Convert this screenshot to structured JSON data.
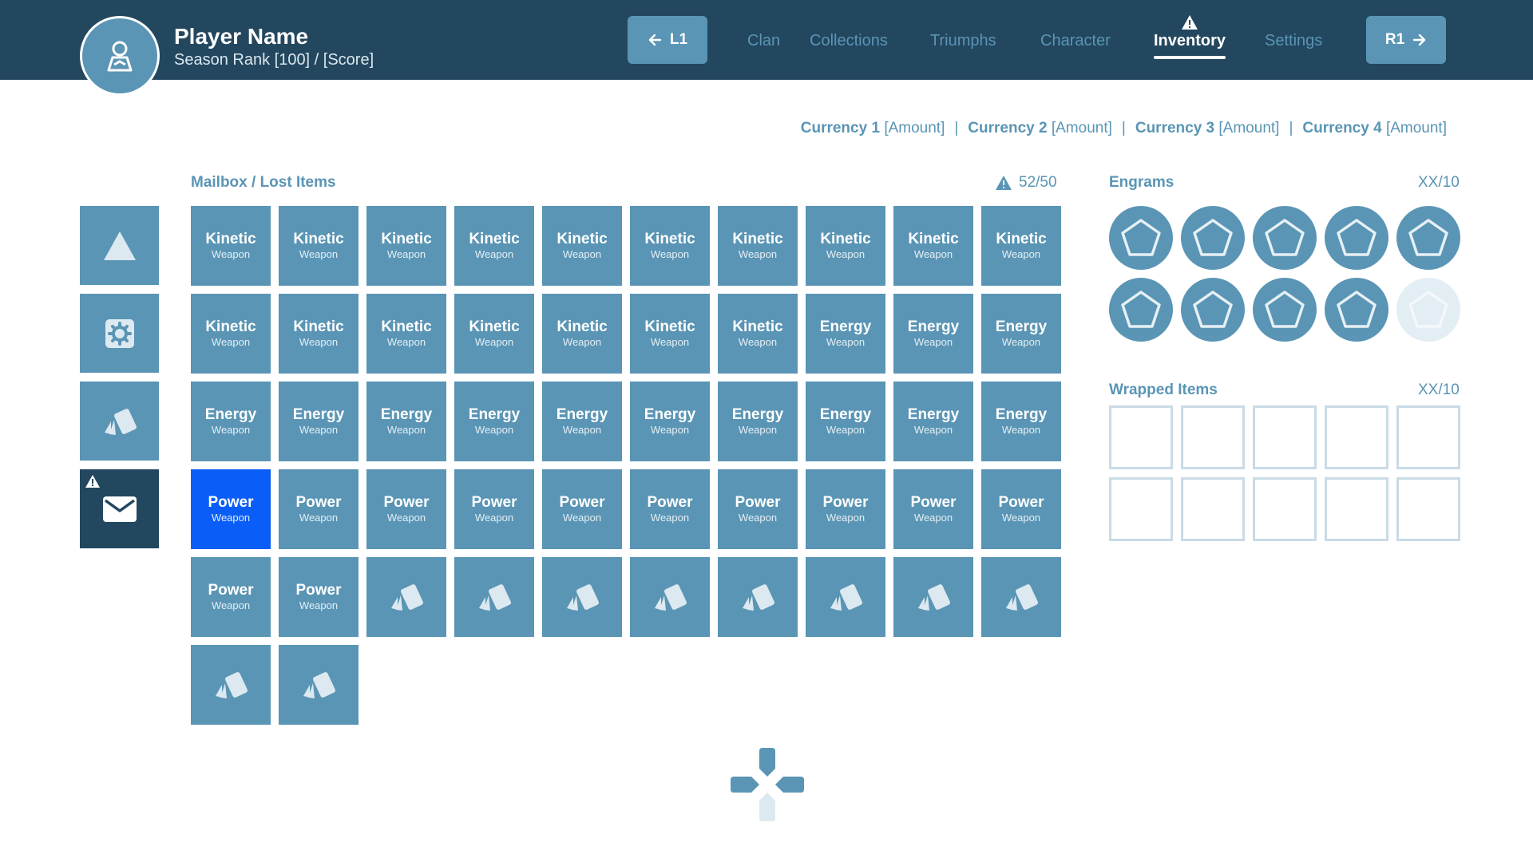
{
  "player": {
    "name": "Player Name",
    "rank": "Season Rank [100] / [Score]"
  },
  "nav": {
    "l1_label": "L1",
    "r1_label": "R1",
    "tabs": [
      {
        "label": "Clan",
        "active": false
      },
      {
        "label": "Collections",
        "active": false
      },
      {
        "label": "Triumphs",
        "active": false
      },
      {
        "label": "Character",
        "active": false
      },
      {
        "label": "Inventory",
        "active": true
      },
      {
        "label": "Settings",
        "active": false
      }
    ]
  },
  "currencies": [
    {
      "name": "Currency 1",
      "amount": "[Amount]"
    },
    {
      "name": "Currency 2",
      "amount": "[Amount]"
    },
    {
      "name": "Currency 3",
      "amount": "[Amount]"
    },
    {
      "name": "Currency 4",
      "amount": "[Amount]"
    }
  ],
  "currency_separator": "|",
  "sidebar": {
    "items": [
      {
        "icon": "triangle-icon"
      },
      {
        "icon": "gear-icon"
      },
      {
        "icon": "cards-icon"
      },
      {
        "icon": "mail-icon",
        "active": true,
        "alert": true
      }
    ]
  },
  "mailbox": {
    "title": "Mailbox / Lost Items",
    "count": "52/50",
    "items": [
      {
        "type": "Kinetic",
        "sub": "Weapon"
      },
      {
        "type": "Kinetic",
        "sub": "Weapon"
      },
      {
        "type": "Kinetic",
        "sub": "Weapon"
      },
      {
        "type": "Kinetic",
        "sub": "Weapon"
      },
      {
        "type": "Kinetic",
        "sub": "Weapon"
      },
      {
        "type": "Kinetic",
        "sub": "Weapon"
      },
      {
        "type": "Kinetic",
        "sub": "Weapon"
      },
      {
        "type": "Kinetic",
        "sub": "Weapon"
      },
      {
        "type": "Kinetic",
        "sub": "Weapon"
      },
      {
        "type": "Kinetic",
        "sub": "Weapon"
      },
      {
        "type": "Kinetic",
        "sub": "Weapon"
      },
      {
        "type": "Kinetic",
        "sub": "Weapon"
      },
      {
        "type": "Kinetic",
        "sub": "Weapon"
      },
      {
        "type": "Kinetic",
        "sub": "Weapon"
      },
      {
        "type": "Kinetic",
        "sub": "Weapon"
      },
      {
        "type": "Kinetic",
        "sub": "Weapon"
      },
      {
        "type": "Kinetic",
        "sub": "Weapon"
      },
      {
        "type": "Energy",
        "sub": "Weapon"
      },
      {
        "type": "Energy",
        "sub": "Weapon"
      },
      {
        "type": "Energy",
        "sub": "Weapon"
      },
      {
        "type": "Energy",
        "sub": "Weapon"
      },
      {
        "type": "Energy",
        "sub": "Weapon"
      },
      {
        "type": "Energy",
        "sub": "Weapon"
      },
      {
        "type": "Energy",
        "sub": "Weapon"
      },
      {
        "type": "Energy",
        "sub": "Weapon"
      },
      {
        "type": "Energy",
        "sub": "Weapon"
      },
      {
        "type": "Energy",
        "sub": "Weapon"
      },
      {
        "type": "Energy",
        "sub": "Weapon"
      },
      {
        "type": "Energy",
        "sub": "Weapon"
      },
      {
        "type": "Energy",
        "sub": "Weapon"
      },
      {
        "type": "Power",
        "sub": "Weapon",
        "selected": true
      },
      {
        "type": "Power",
        "sub": "Weapon"
      },
      {
        "type": "Power",
        "sub": "Weapon"
      },
      {
        "type": "Power",
        "sub": "Weapon"
      },
      {
        "type": "Power",
        "sub": "Weapon"
      },
      {
        "type": "Power",
        "sub": "Weapon"
      },
      {
        "type": "Power",
        "sub": "Weapon"
      },
      {
        "type": "Power",
        "sub": "Weapon"
      },
      {
        "type": "Power",
        "sub": "Weapon"
      },
      {
        "type": "Power",
        "sub": "Weapon"
      },
      {
        "type": "Power",
        "sub": "Weapon"
      },
      {
        "type": "Power",
        "sub": "Weapon"
      },
      {
        "icon": "cards-icon"
      },
      {
        "icon": "cards-icon"
      },
      {
        "icon": "cards-icon"
      },
      {
        "icon": "cards-icon"
      },
      {
        "icon": "cards-icon"
      },
      {
        "icon": "cards-icon"
      },
      {
        "icon": "cards-icon"
      },
      {
        "icon": "cards-icon"
      },
      {
        "icon": "cards-icon"
      },
      {
        "icon": "cards-icon"
      }
    ]
  },
  "engrams": {
    "title": "Engrams",
    "count": "XX/10",
    "filled": 9,
    "total": 10
  },
  "wrapped": {
    "title": "Wrapped Items",
    "count": "XX/10",
    "total": 10
  },
  "colors": {
    "header_bg": "#23475f",
    "accent": "#5a95b5",
    "selected": "#0a5ef7",
    "empty_engram": "#e3eef4",
    "slot_border": "#c9dbe6"
  }
}
